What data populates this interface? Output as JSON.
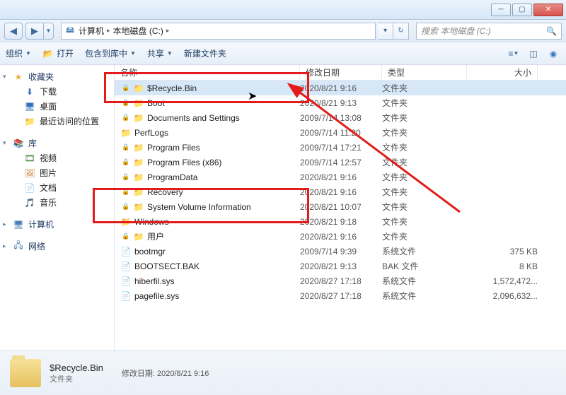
{
  "navbar": {
    "breadcrumb": [
      "计算机",
      "本地磁盘 (C:)"
    ],
    "search_placeholder": "搜索 本地磁盘 (C:)"
  },
  "toolbar": {
    "organize": "组织",
    "open": "打开",
    "include": "包含到库中",
    "share": "共享",
    "newfolder": "新建文件夹"
  },
  "sidebar": {
    "favorites": {
      "label": "收藏夹",
      "items": [
        "下载",
        "桌面",
        "最近访问的位置"
      ]
    },
    "libraries": {
      "label": "库",
      "items": [
        "视频",
        "图片",
        "文档",
        "音乐"
      ]
    },
    "computer": {
      "label": "计算机"
    },
    "network": {
      "label": "网络"
    }
  },
  "columns": {
    "name": "名称",
    "date": "修改日期",
    "type": "类型",
    "size": "大小"
  },
  "files": [
    {
      "name": "$Recycle.Bin",
      "date": "2020/8/21 9:16",
      "type": "文件夹",
      "size": "",
      "icon": "folder-lock",
      "sel": true
    },
    {
      "name": "Boot",
      "date": "2020/8/21 9:13",
      "type": "文件夹",
      "size": "",
      "icon": "folder-lock"
    },
    {
      "name": "Documents and Settings",
      "date": "2009/7/14 13:08",
      "type": "文件夹",
      "size": "",
      "icon": "folder-lock"
    },
    {
      "name": "PerfLogs",
      "date": "2009/7/14 11:20",
      "type": "文件夹",
      "size": "",
      "icon": "folder"
    },
    {
      "name": "Program Files",
      "date": "2009/7/14 17:21",
      "type": "文件夹",
      "size": "",
      "icon": "folder-lock"
    },
    {
      "name": "Program Files (x86)",
      "date": "2009/7/14 12:57",
      "type": "文件夹",
      "size": "",
      "icon": "folder-lock"
    },
    {
      "name": "ProgramData",
      "date": "2020/8/21 9:16",
      "type": "文件夹",
      "size": "",
      "icon": "folder-lock"
    },
    {
      "name": "Recovery",
      "date": "2020/8/21 9:16",
      "type": "文件夹",
      "size": "",
      "icon": "folder-lock"
    },
    {
      "name": "System Volume Information",
      "date": "2020/8/21 10:07",
      "type": "文件夹",
      "size": "",
      "icon": "folder-lock"
    },
    {
      "name": "Windows",
      "date": "2020/8/21 9:18",
      "type": "文件夹",
      "size": "",
      "icon": "folder"
    },
    {
      "name": "用户",
      "date": "2020/8/21 9:16",
      "type": "文件夹",
      "size": "",
      "icon": "folder-lock"
    },
    {
      "name": "bootmgr",
      "date": "2009/7/14 9:39",
      "type": "系统文件",
      "size": "375 KB",
      "icon": "file"
    },
    {
      "name": "BOOTSECT.BAK",
      "date": "2020/8/21 9:13",
      "type": "BAK 文件",
      "size": "8 KB",
      "icon": "file"
    },
    {
      "name": "hiberfil.sys",
      "date": "2020/8/27 17:18",
      "type": "系统文件",
      "size": "1,572,472...",
      "icon": "file"
    },
    {
      "name": "pagefile.sys",
      "date": "2020/8/27 17:18",
      "type": "系统文件",
      "size": "2,096,632...",
      "icon": "file"
    }
  ],
  "details": {
    "name": "$Recycle.Bin",
    "type": "文件夹",
    "date_label": "修改日期:",
    "date": "2020/8/21 9:16"
  }
}
